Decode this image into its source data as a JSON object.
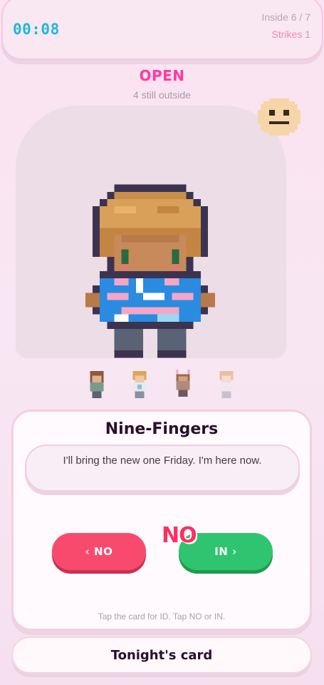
{
  "hud": {
    "timer": "00:08",
    "inside": "Inside 6 / 7",
    "strikes": "Strikes 1"
  },
  "door": {
    "status": "OPEN",
    "substatus": "4 still outside"
  },
  "icons": {
    "mood": "neutral-face-icon",
    "visitor": "visitor-sprite"
  },
  "queue": [
    "brown-hair-visitor",
    "blond-hair-visitor",
    "bunny-ears-visitor",
    "pale-visitor"
  ],
  "card": {
    "name": "Nine-Fingers",
    "quote": "I'll bring the new one Friday. I'm here now.",
    "no_label": "‹ NO",
    "in_label": "IN ›",
    "verdict": "NO",
    "hint": "Tap the card for ID. Tap NO or IN."
  },
  "footer": {
    "label": "Tonight's card"
  },
  "colors": {
    "accent_open": "#ff3aa3",
    "timer": "#20b8d8",
    "no_button": "#f84a6c",
    "in_button": "#2fc46f",
    "strikes": "#f08ab0"
  }
}
